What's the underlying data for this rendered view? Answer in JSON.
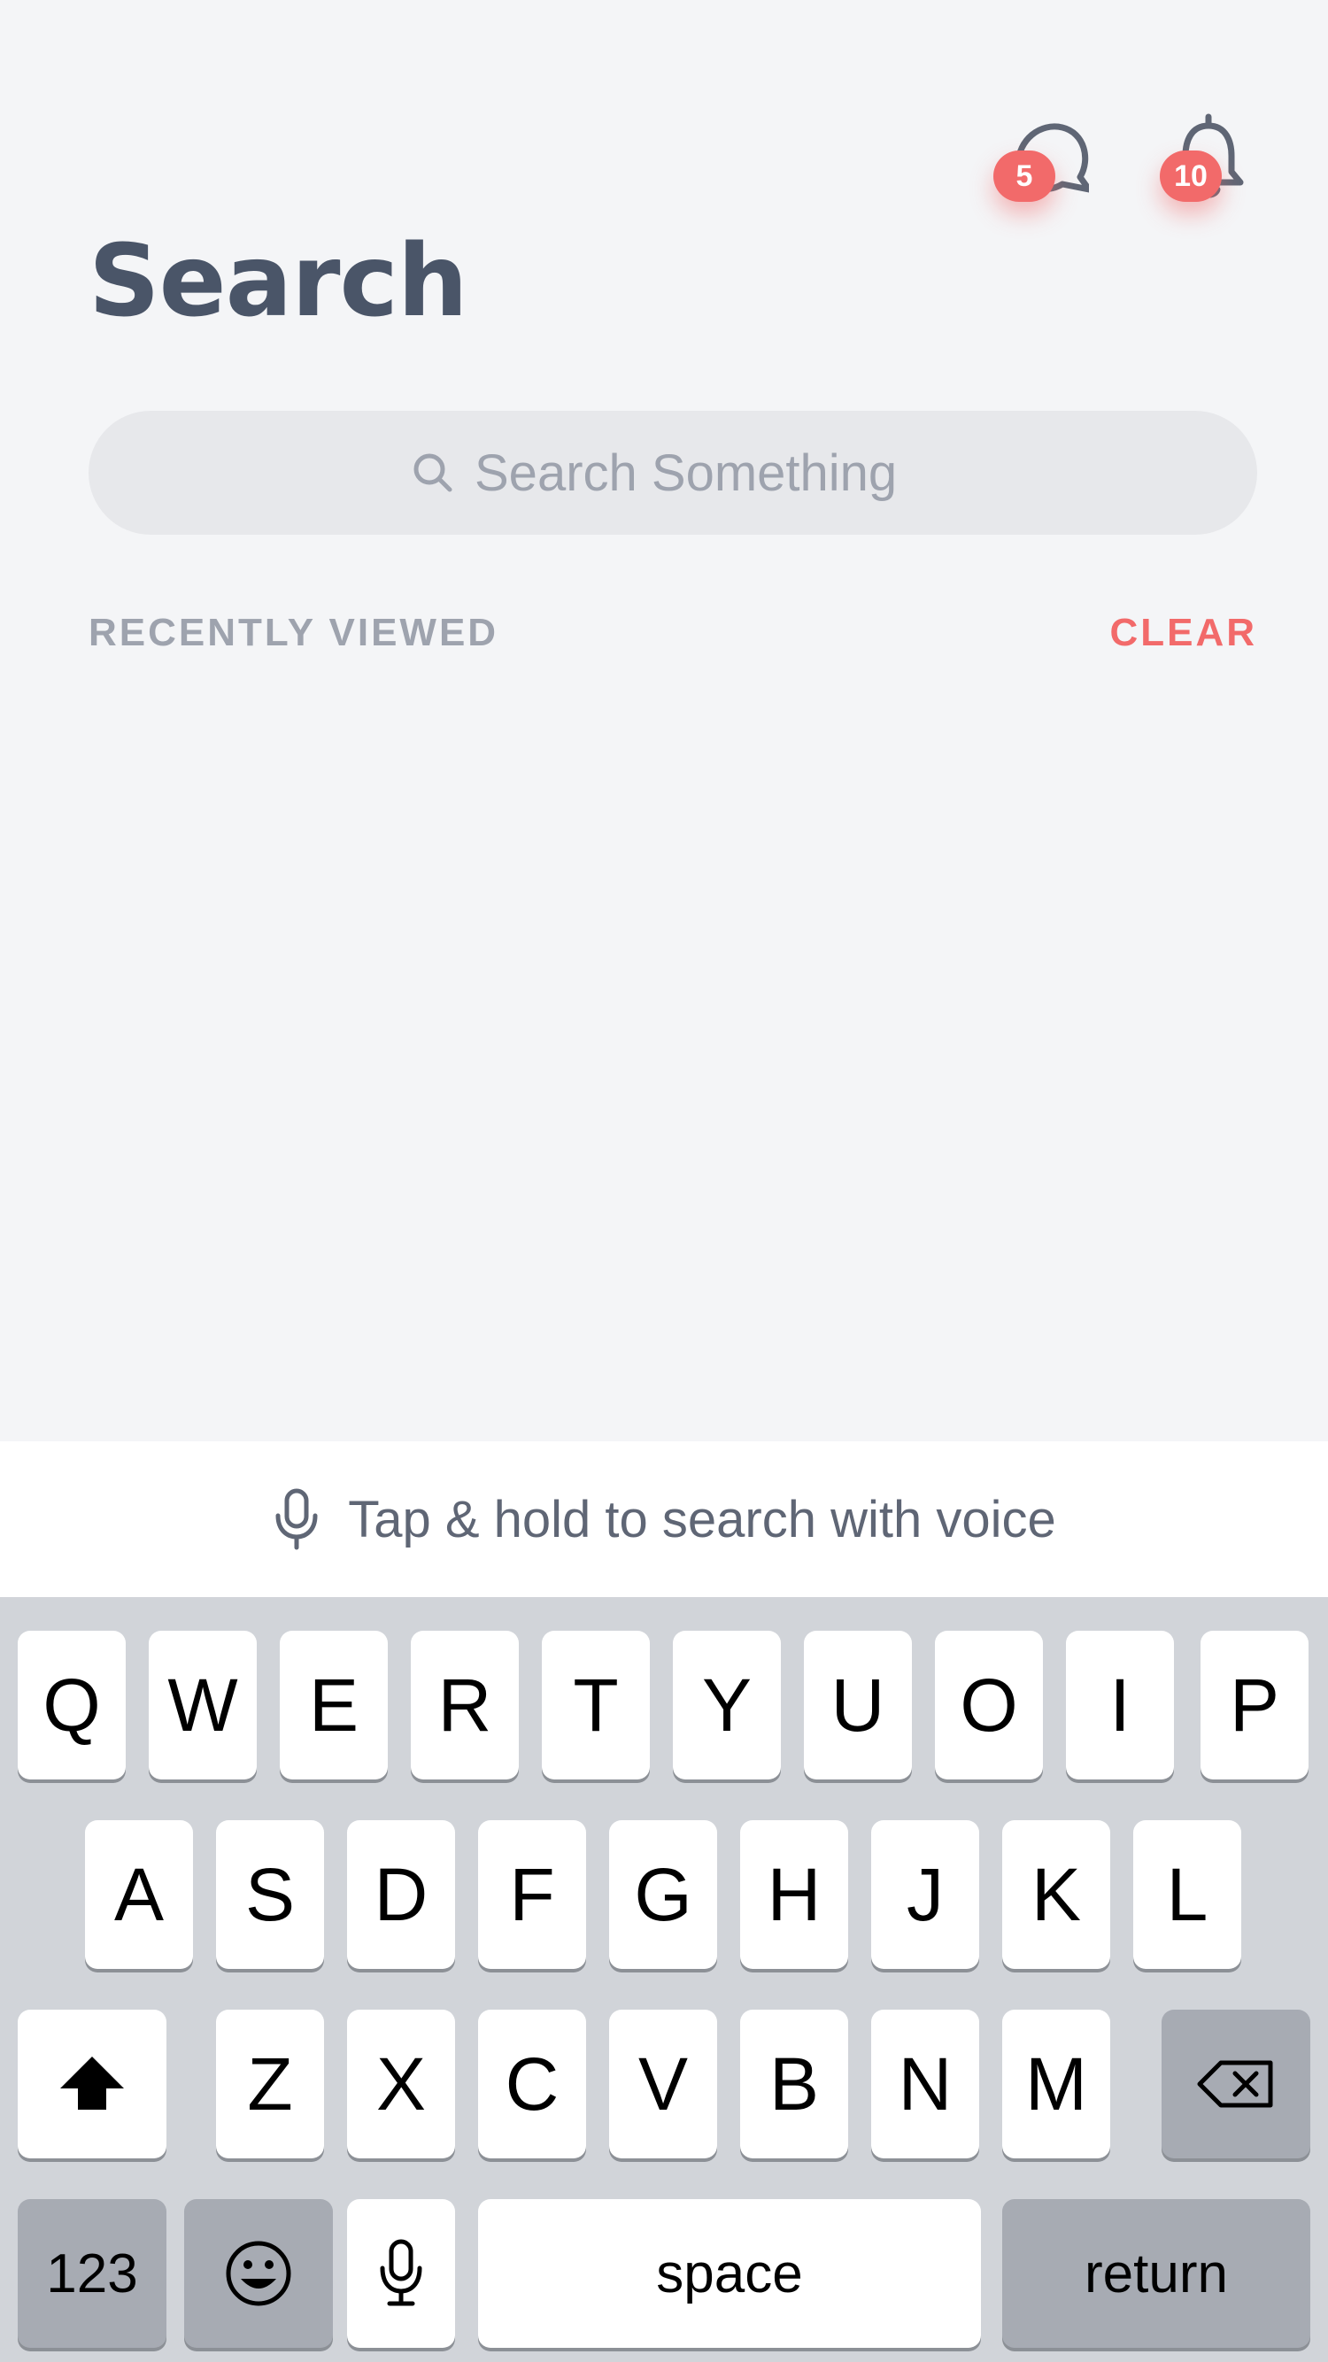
{
  "header": {
    "title": "Search",
    "messages_badge": "5",
    "notifications_badge": "10"
  },
  "search": {
    "placeholder": "Search Something",
    "value": ""
  },
  "recent": {
    "label": "RECENTLY VIEWED",
    "clear_label": "CLEAR"
  },
  "voice": {
    "hint": "Tap & hold to search with voice"
  },
  "keyboard": {
    "row1": [
      "Q",
      "W",
      "E",
      "R",
      "T",
      "Y",
      "U",
      "O",
      "I",
      "P"
    ],
    "row2": [
      "A",
      "S",
      "D",
      "F",
      "G",
      "H",
      "J",
      "K",
      "L"
    ],
    "row3": [
      "Z",
      "X",
      "C",
      "V",
      "B",
      "N",
      "M"
    ],
    "numbers_label": "123",
    "space_label": "space",
    "return_label": "return"
  },
  "colors": {
    "background": "#F4F5F7",
    "title": "#4A5568",
    "accent": "#F26A6A",
    "muted_text": "#9EA3AE",
    "search_bg": "#E7E8EB",
    "keyboard_bg": "#D1D4D9"
  },
  "icons": {
    "messages": "chat-bubble-icon",
    "notifications": "bell-icon",
    "search": "search-icon",
    "voice": "microphone-icon",
    "shift": "shift-arrow-icon",
    "backspace": "backspace-icon",
    "emoji": "emoji-icon",
    "dictation": "microphone-icon"
  }
}
